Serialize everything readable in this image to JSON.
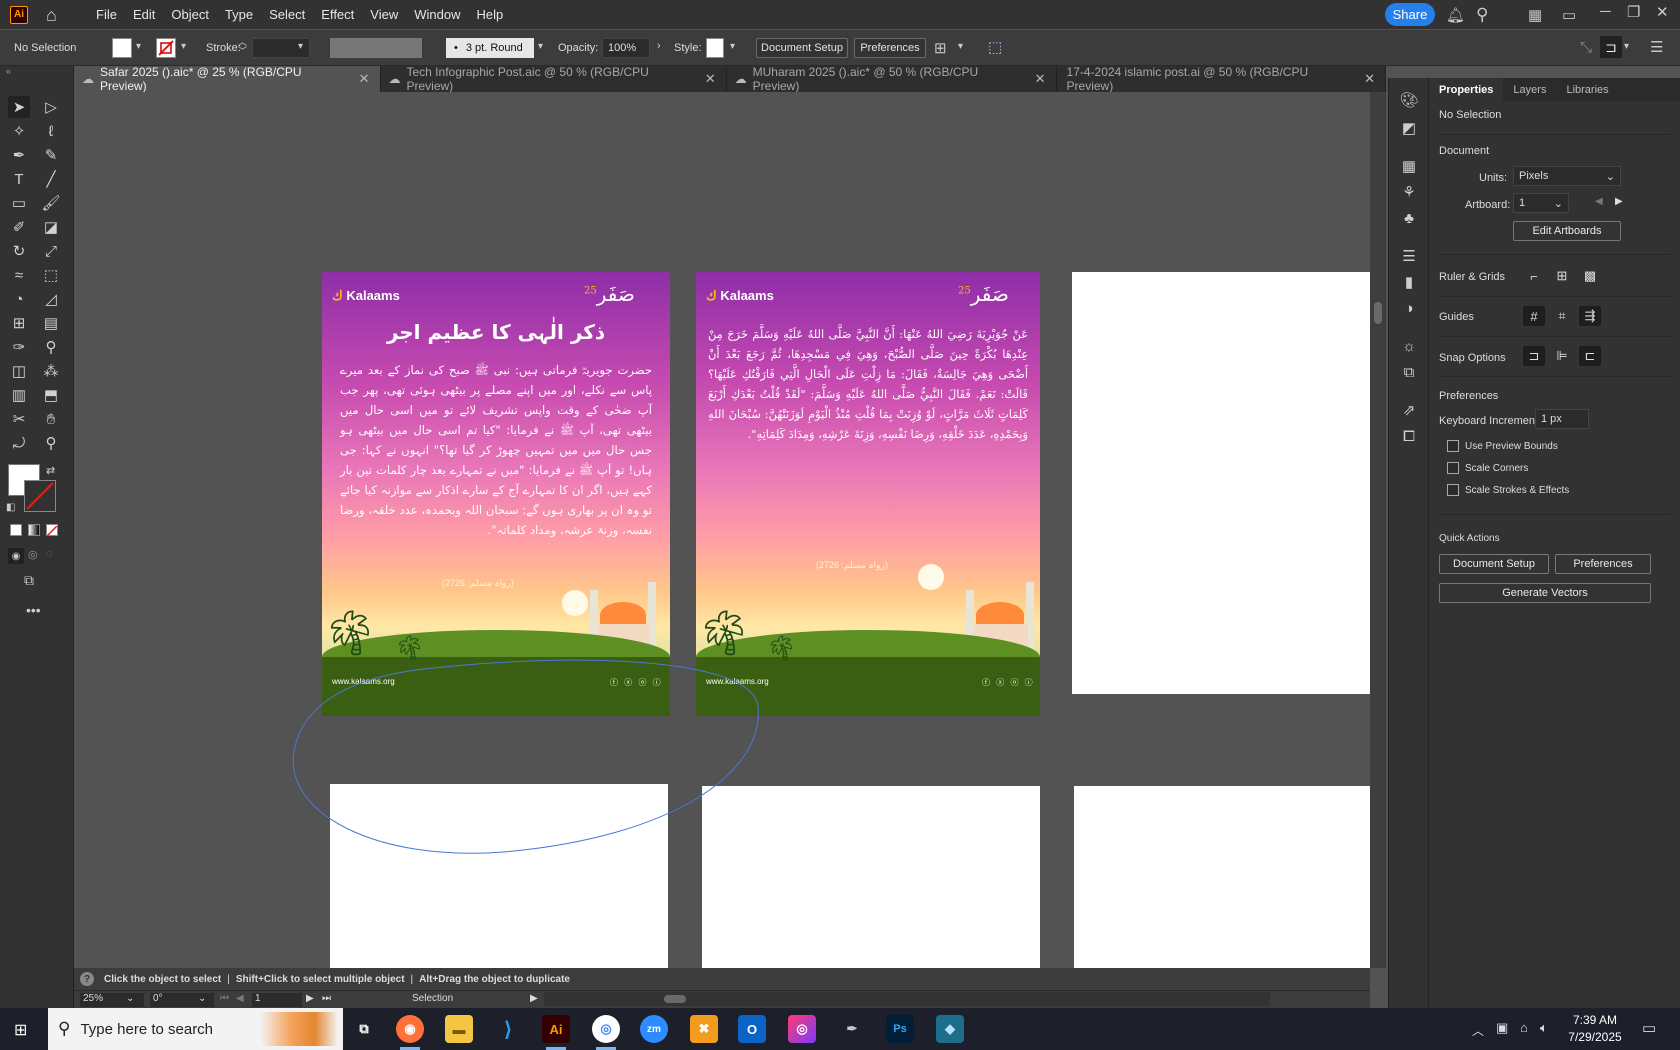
{
  "app": {
    "logo": "Ai",
    "menu": [
      "File",
      "Edit",
      "Object",
      "Type",
      "Select",
      "Effect",
      "View",
      "Window",
      "Help"
    ],
    "share_label": "Share"
  },
  "controlbar": {
    "selection": "No Selection",
    "stroke_label": "Stroke:",
    "brush": "3 pt. Round",
    "opacity_label": "Opacity:",
    "opacity_value": "100%",
    "style_label": "Style:",
    "doc_setup": "Document Setup",
    "preferences": "Preferences"
  },
  "tabs": [
    {
      "label": "Safar 2025 ().aic* @ 25 % (RGB/CPU Preview)",
      "active": true
    },
    {
      "label": "Tech Infographic Post.aic @ 50 % (RGB/CPU Preview)",
      "active": false
    },
    {
      "label": "MUharam 2025 ().aic* @ 50 % (RGB/CPU Preview)",
      "active": false
    },
    {
      "label": "17-4-2024 islamic post.ai @ 50 % (RGB/CPU Preview)",
      "active": false
    }
  ],
  "poster1": {
    "brand": "Kalaams",
    "safar": "صَفَر",
    "year": "25",
    "title": "ذکر الٰہی کا عظیم اجر",
    "body": "حضرت جویریہؓ فرماتی ہیں: نبی ﷺ صبح کی نماز کے بعد میرے پاس سے نکلے، اور میں اپنے مصلے پر بیٹھی ہوئی تھی، پھر جب آپ ضحٰی کے وقت واپس تشریف لائے تو میں اسی حال میں بیٹھی تھی، آپ ﷺ نے فرمایا: \"کیا تم اسی حال میں بیٹھی ہو جس حال میں میں تمہیں چھوڑ کر گیا تھا؟\" انہوں نے کہا: جی ہاں! تو آپ ﷺ نے فرمایا: \"میں نے تمہارے بعد چار کلمات تین بار کہے ہیں، اگر ان کا تمہارے آج کے سارے اذکار سے موازنہ کیا جائے تو وہ ان پر بھاری ہوں گے: سبحان اللہ وبحمدہ، عدد خلقہ، ورضا نفسہ، وزنۃ عرشہ، ومداد کلماتہ\".",
    "ref": "(رواہ مسلم: 2726)",
    "site": "www.kalaams.org",
    "social": "ⓕ ⓧ ⓞ ⓘ"
  },
  "poster2": {
    "brand": "Kalaams",
    "safar": "صَفَر",
    "year": "25",
    "body": "عَنْ جُوَيْرِيَةَ رَضِيَ اللهُ عَنْهَا: أَنَّ النَّبِيَّ صَلَّى اللهُ عَلَيْهِ وَسَلَّمَ خَرَجَ مِنْ عِنْدِهَا بُكْرَةً حِينَ صَلَّى الصُّبْحَ، وَهِيَ فِي مَسْجِدِهَا، ثُمَّ رَجَعَ بَعْدَ أَنْ أَضْحَى وَهِيَ جَالِسَةٌ، فَقَالَ: مَا زِلْتِ عَلَى الْحَالِ الَّتِي فَارَقْتُكِ عَلَيْهَا؟ قَالَتْ: نَعَمْ. فَقَالَ النَّبِيُّ صَلَّى اللهُ عَلَيْهِ وَسَلَّمَ: \"لَقَدْ قُلْتُ بَعْدَكِ أَرْبَعَ كَلِمَاتٍ ثَلَاثَ مَرَّاتٍ، لَوْ وُزِنَتْ بِمَا قُلْتِ مُنْذُ الْيَوْمِ لَوَزَنَتْهُنَّ: سُبْحَانَ اللهِ وَبِحَمْدِهِ، عَدَدَ خَلْقِهِ، وَرِضَا نَفْسِهِ، وَزِنَةَ عَرْشِهِ، وَمِدَادَ كَلِمَاتِهِ\".",
    "ref": "(رواہ مسلم: 2726)",
    "site": "www.kalaams.org",
    "social": "ⓕ ⓧ ⓞ ⓘ"
  },
  "properties": {
    "tabs": [
      "Properties",
      "Layers",
      "Libraries"
    ],
    "selection": "No Selection",
    "document_heading": "Document",
    "units_label": "Units:",
    "units_value": "Pixels",
    "artboard_label": "Artboard:",
    "artboard_value": "1",
    "edit_artboards": "Edit Artboards",
    "ruler_grids": "Ruler & Grids",
    "guides": "Guides",
    "snap_options": "Snap Options",
    "preferences_heading": "Preferences",
    "keyboard_increment_label": "Keyboard Increment:",
    "keyboard_increment_value": "1 px",
    "use_preview_bounds": "Use Preview Bounds",
    "scale_corners": "Scale Corners",
    "scale_strokes": "Scale Strokes & Effects",
    "quick_actions": "Quick Actions",
    "doc_setup": "Document Setup",
    "preferences_btn": "Preferences",
    "generate_vectors": "Generate Vectors"
  },
  "hint": {
    "part1": "Click the object to select",
    "part2": "Shift+Click to select multiple object",
    "part3": "Alt+Drag the object to duplicate"
  },
  "status": {
    "zoom": "25%",
    "rotation": "0°",
    "artboard": "1",
    "tool": "Selection"
  },
  "taskbar": {
    "search_placeholder": "Type here to search",
    "time": "7:39 AM",
    "date": "7/29/2025"
  }
}
